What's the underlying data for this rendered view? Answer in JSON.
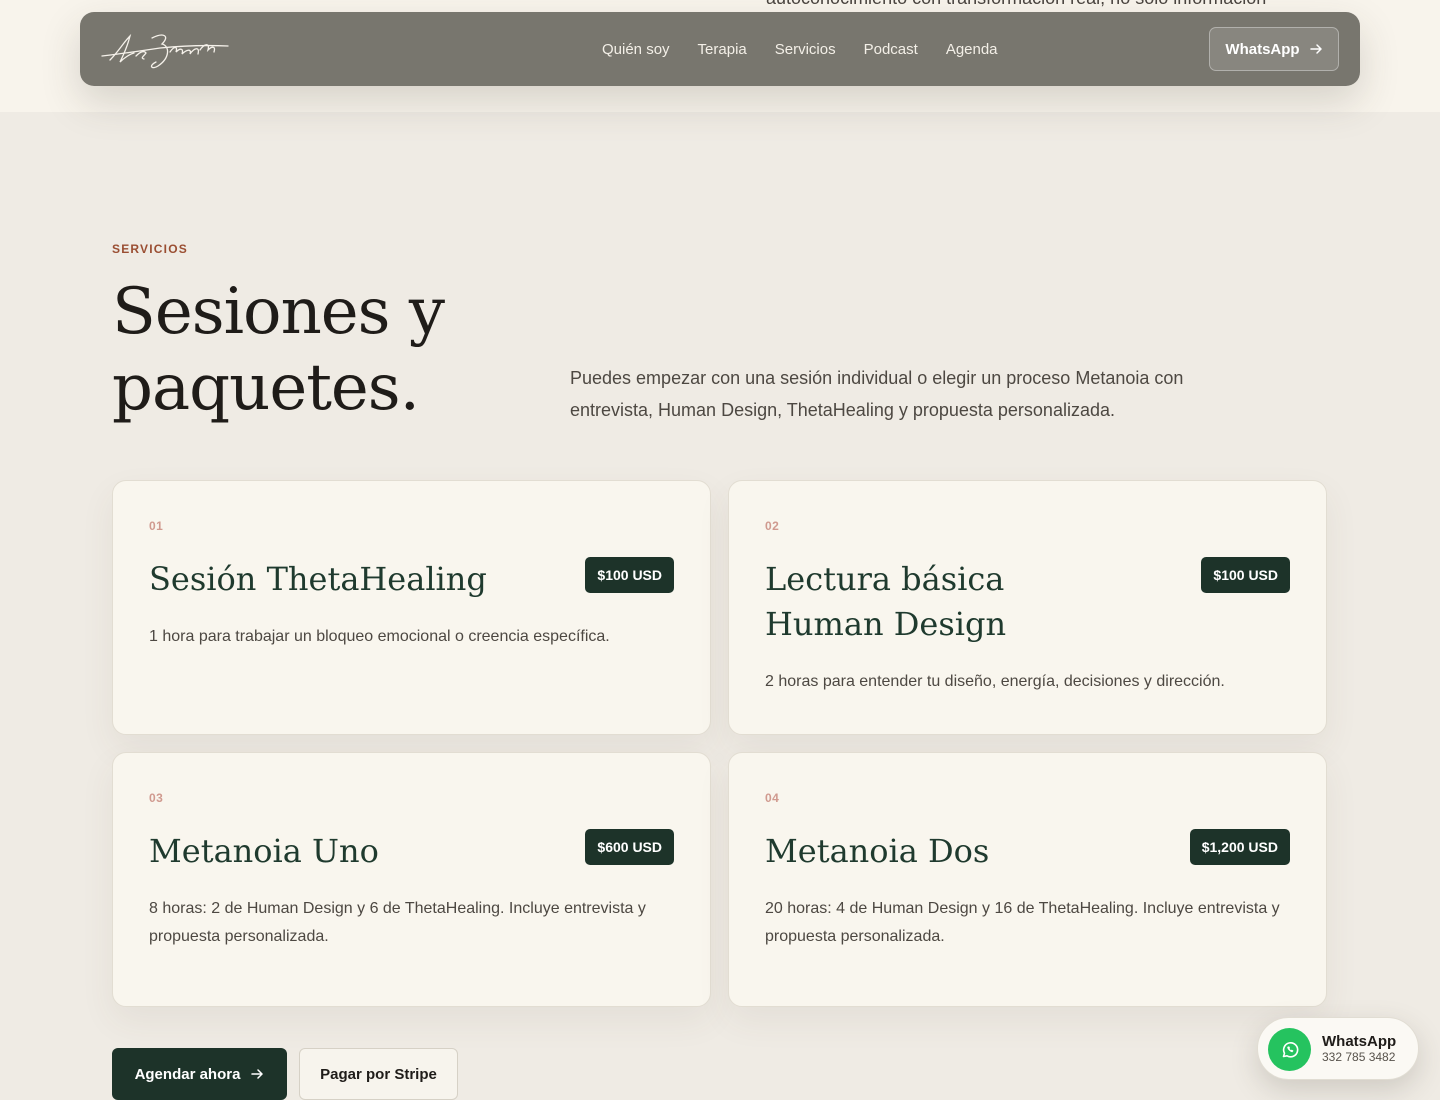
{
  "previous_section": {
    "tail_text": "autoconocimiento con transformación real, no solo información"
  },
  "nav": {
    "links": [
      "Quién soy",
      "Terapia",
      "Servicios",
      "Podcast",
      "Agenda"
    ],
    "cta_label": "WhatsApp"
  },
  "section": {
    "eyebrow": "SERVICIOS",
    "heading": "Sesiones y paquetes.",
    "intro": "Puedes empezar con una sesión individual o elegir un proceso Metanoia con entrevista, Human Design, ThetaHealing y propuesta personalizada."
  },
  "cards": [
    {
      "num": "01",
      "title": "Sesión ThetaHealing",
      "price": "$100 USD",
      "desc": "1 hora para trabajar un bloqueo emocional o creencia específica."
    },
    {
      "num": "02",
      "title": "Lectura básica Human Design",
      "price": "$100 USD",
      "desc": "2 horas para entender tu diseño, energía, decisiones y dirección."
    },
    {
      "num": "03",
      "title": "Metanoia Uno",
      "price": "$600 USD",
      "desc": "8 horas: 2 de Human Design y 6 de ThetaHealing. Incluye entrevista y propuesta personalizada."
    },
    {
      "num": "04",
      "title": "Metanoia Dos",
      "price": "$1,200 USD",
      "desc": "20 horas: 4 de Human Design y 16 de ThetaHealing. Incluye entrevista y propuesta personalizada."
    }
  ],
  "actions": {
    "primary_label": "Agendar ahora",
    "secondary_label": "Pagar por Stripe"
  },
  "whatsapp_float": {
    "title": "WhatsApp",
    "phone": "332 785 3482"
  },
  "colors": {
    "accent_dark_green": "#1d3329",
    "eyebrow_rust": "#9a4e32",
    "whatsapp_green": "#25c35f",
    "card_number_pink": "#d09a8f"
  },
  "icons": [
    "signature-logo",
    "arrow-right-icon",
    "whatsapp-icon"
  ]
}
